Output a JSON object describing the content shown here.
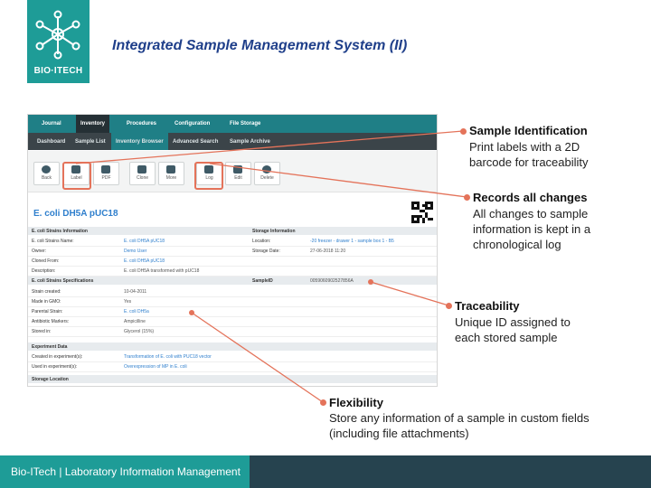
{
  "logo": {
    "text": "BIO·ITECH"
  },
  "slide_title": "Integrated Sample Management System (II)",
  "app": {
    "top_nav": [
      "Journal",
      "Inventory",
      "Procedures",
      "Configuration",
      "File Storage"
    ],
    "top_nav_active": "Inventory",
    "sub_nav": [
      "Dashboard",
      "Sample List",
      "Inventory Browser",
      "Advanced Search",
      "Sample Archive"
    ],
    "sub_nav_active": "Inventory Browser",
    "toolbar": [
      {
        "label": "Back",
        "icon": "back-icon"
      },
      {
        "label": "Label",
        "icon": "label-icon"
      },
      {
        "label": "PDF",
        "icon": "print-icon"
      },
      {
        "label": "Clone",
        "icon": "clone-icon"
      },
      {
        "label": "More",
        "icon": "more-icon"
      },
      {
        "label": "Log",
        "icon": "log-icon"
      },
      {
        "label": "Edit",
        "icon": "edit-icon"
      },
      {
        "label": "Delete",
        "icon": "delete-icon"
      }
    ],
    "sample_name": "E. coli DH5A pUC18",
    "section_strain": "E. coli Strains Information",
    "section_storage": "Storage Information",
    "fields_left": [
      {
        "key": "E. coli Strains Name:",
        "value": "E. coli DH5A pUC18"
      },
      {
        "key": "Owner:",
        "value": "Demo User"
      },
      {
        "key": "Cloned From:",
        "value": "E. coli DH5A pUC18"
      },
      {
        "key": "Description:",
        "value": "E. coli DH5A transformed with pUC18"
      }
    ],
    "fields_right": [
      {
        "key": "Location:",
        "value": "-20 freezer - drawer 1 - sample box 1 - B5"
      },
      {
        "key": "Storage Date:",
        "value": "27-06-2018 11:20"
      }
    ],
    "section_specs": "E. coli Strains Specifications",
    "sample_id_label": "SampleID",
    "sample_id_value": "0059060902527856A",
    "spec_fields": [
      {
        "key": "Strain created:",
        "value": "10-04-2011"
      },
      {
        "key": "Made in GMO:",
        "value": "Yes"
      },
      {
        "key": "Parental Strain:",
        "value": "E. coli DH5a"
      },
      {
        "key": "Antibiotic Markers:",
        "value": "Ampicilline"
      },
      {
        "key": "Stored in:",
        "value": "Glycerol (15%)"
      }
    ],
    "section_experiment": "Experiment Data",
    "experiment_fields": [
      {
        "key": "Created in experiment(s):",
        "value": "Transformation of E. coli with PUC18 vector"
      },
      {
        "key": "Used in experiment(s):",
        "value": "Overexpression of MP in E. coli"
      }
    ],
    "section_location": "Storage Location"
  },
  "callouts": [
    {
      "title": "Sample Identification",
      "text": "Print labels with a 2D barcode for traceability"
    },
    {
      "title": "Records all changes",
      "text": "All changes to sample information is kept in a chronological log"
    },
    {
      "title": "Traceability",
      "text": "Unique ID assigned to each stored sample"
    },
    {
      "title": "Flexibility",
      "text": "Store any information of a sample in custom fields (including file attachments)"
    }
  ],
  "footer": "Bio-ITech | Laboratory Information Management",
  "colors": {
    "accent": "#1e9c97",
    "callout": "#e4735a",
    "title": "#1f3f8a",
    "footer_dark": "#26434f"
  }
}
